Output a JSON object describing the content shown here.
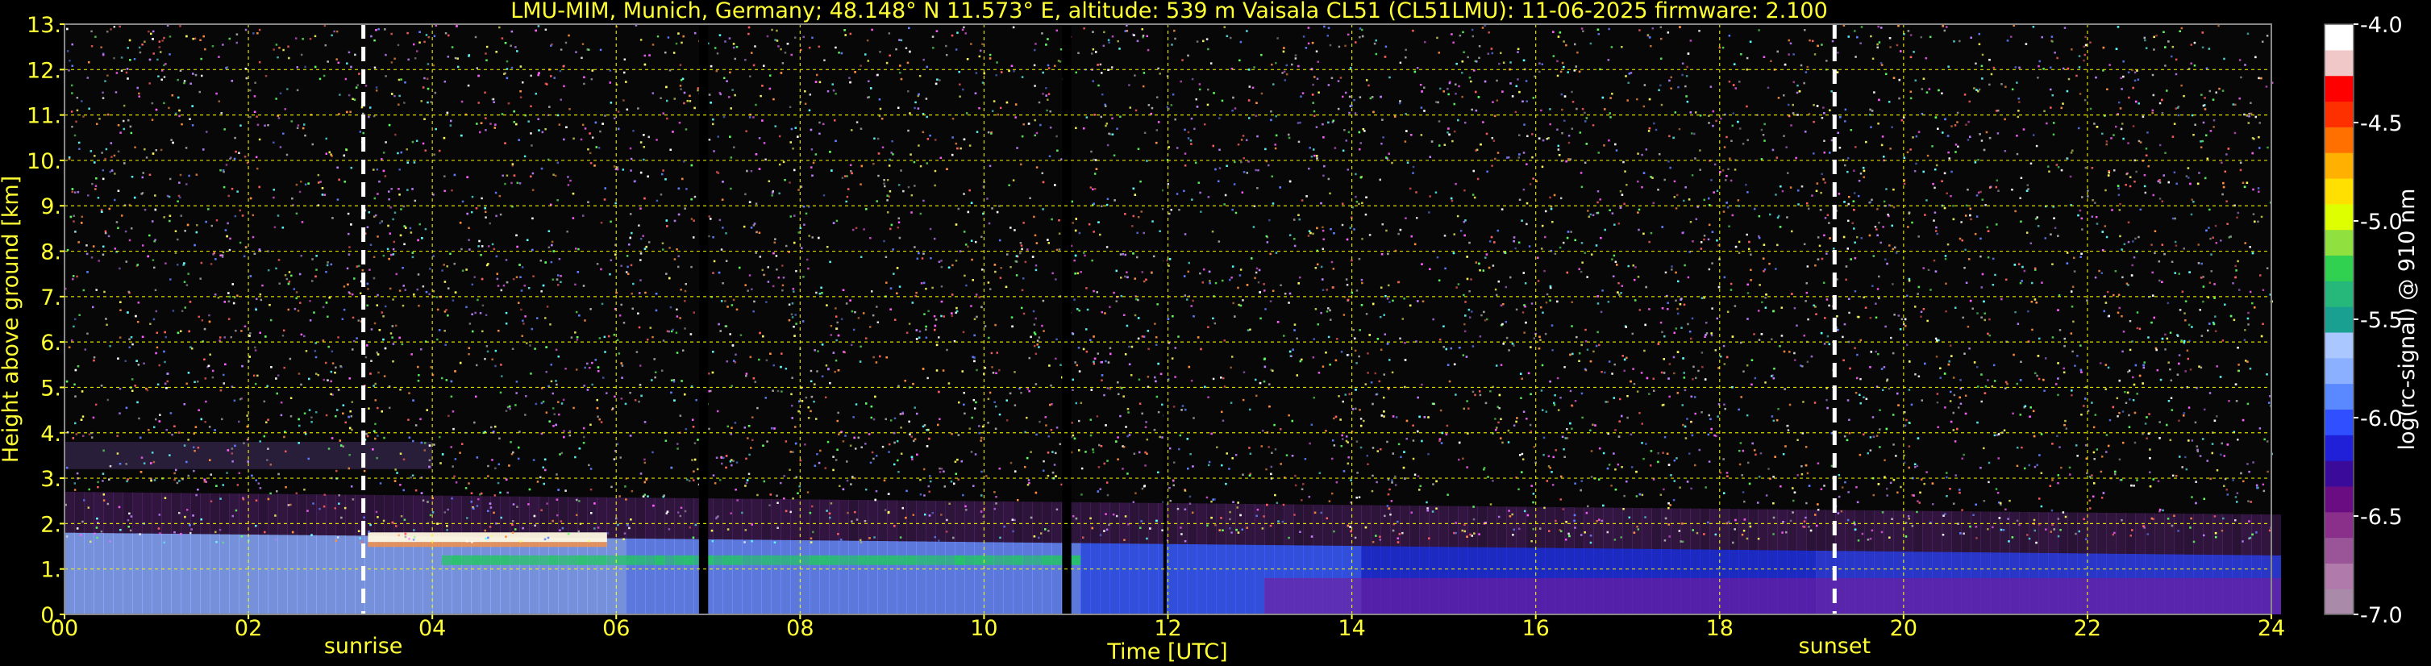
{
  "chart_data": {
    "type": "heatmap",
    "title": "LMU-MIM, Munich, Germany; 48.148° N 11.573° E, altitude: 539 m    Vaisala CL51 (CL51LMU): 11-06-2025    firmware: 2.100",
    "xlabel": "Time [UTC]",
    "ylabel": "Height above ground [km]",
    "xlim": [
      0,
      24
    ],
    "ylim": [
      0,
      13
    ],
    "x_ticks": [
      "00",
      "02",
      "04",
      "06",
      "08",
      "10",
      "12",
      "14",
      "16",
      "18",
      "20",
      "22",
      "24"
    ],
    "x_tick_values": [
      0,
      2,
      4,
      6,
      8,
      10,
      12,
      14,
      16,
      18,
      20,
      22,
      24
    ],
    "y_ticks": [
      "0.",
      "1.",
      "2.",
      "3.",
      "4.",
      "5.",
      "6.",
      "7.",
      "8.",
      "9.",
      "10.",
      "11.",
      "12.",
      "13."
    ],
    "y_tick_values": [
      0,
      1,
      2,
      3,
      4,
      5,
      6,
      7,
      8,
      9,
      10,
      11,
      12,
      13
    ],
    "grid": true,
    "grid_color": "#ffff00",
    "colorbar": {
      "label": "log(rc-signal) @ 910 nm",
      "range": [
        -7.0,
        -4.0
      ],
      "ticks": [
        "-4.0",
        "-4.5",
        "-5.0",
        "-5.5",
        "-6.0",
        "-6.5",
        "-7.0"
      ],
      "tick_values": [
        -4.0,
        -4.5,
        -5.0,
        -5.5,
        -6.0,
        -6.5,
        -7.0
      ],
      "colors": [
        "#a98aa8",
        "#b07aaa",
        "#9a5598",
        "#8a2f8a",
        "#6a0d82",
        "#3a0a9a",
        "#2020d8",
        "#3050ff",
        "#5a88ff",
        "#8ab0ff",
        "#aac8ff",
        "#1aa090",
        "#25b87a",
        "#30d050",
        "#90e040",
        "#ddff00",
        "#ffe000",
        "#ffb000",
        "#ff7000",
        "#ff3000",
        "#ff0000",
        "#f0c8c8",
        "#ffffff"
      ]
    },
    "events": [
      {
        "label": "sunrise",
        "time": 3.25
      },
      {
        "label": "sunset",
        "time": 19.25
      }
    ],
    "data_gaps": [
      {
        "start": 6.9,
        "end": 7.0
      },
      {
        "start": 10.85,
        "end": 10.95
      },
      {
        "start": 11.95,
        "end": 11.98
      }
    ],
    "features": [
      {
        "name": "boundary layer top",
        "height_start_km": 1.8,
        "height_end_km": 1.3
      },
      {
        "name": "cloud layer",
        "time_start": 3.3,
        "time_end": 5.9,
        "height_km": 1.7
      },
      {
        "name": "upper aerosol layer",
        "time_start": 0,
        "time_end": 4.0,
        "height_km": 3.5
      }
    ]
  }
}
